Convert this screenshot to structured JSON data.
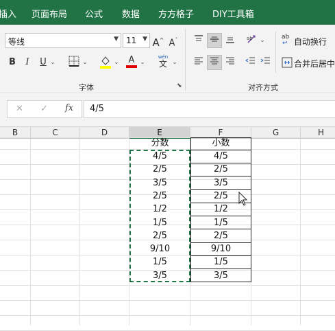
{
  "tabs": [
    "插入",
    "页面布局",
    "公式",
    "数据",
    "方方格子",
    "DIY工具箱"
  ],
  "ribbon": {
    "font_name": "等线",
    "font_size": "11",
    "grow_font": "A",
    "shrink_font": "A",
    "bold": "B",
    "italic": "I",
    "underline": "U",
    "font_color_letter": "A",
    "phonetic_top": "wén",
    "phonetic_bottom": "文",
    "group_font": "字体",
    "group_align": "对齐方式",
    "wrap_text": "自动换行",
    "merge_center": "合并后居中",
    "wrap_icon_text": "ab",
    "highlight_color": "#ffff00",
    "font_color": "#e00000"
  },
  "formula_bar": {
    "cancel": "✕",
    "confirm": "✓",
    "fx": "fx",
    "value": "4/5"
  },
  "columns": [
    "B",
    "C",
    "D",
    "E",
    "F",
    "G",
    "H"
  ],
  "active_column": "E",
  "table": {
    "headers": [
      "分数",
      "小数"
    ],
    "fraction": [
      "4/5",
      "2/5",
      "3/5",
      "2/5",
      "1/2",
      "1/5",
      "2/5",
      "9/10",
      "1/5",
      "3/5"
    ],
    "decimal": [
      "4/5",
      "2/5",
      "3/5",
      "2/5",
      "1/2",
      "1/5",
      "2/5",
      "9/10",
      "1/5",
      "3/5"
    ]
  },
  "accent_color": "#217346"
}
